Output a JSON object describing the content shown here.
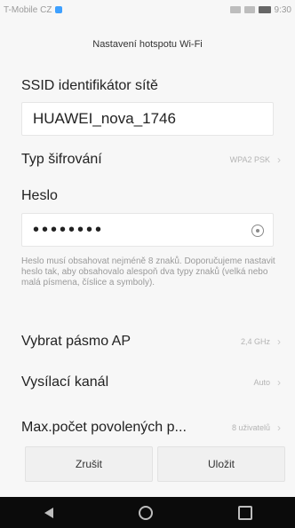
{
  "status_bar": {
    "carrier": "T-Mobile CZ",
    "time": "9:30"
  },
  "title": "Nastavení hotspotu Wi‑Fi",
  "ssid": {
    "label": "SSID identifikátor sítě",
    "value": "HUAWEI_nova_1746"
  },
  "encryption": {
    "label": "Typ šifrování",
    "value": "WPA2 PSK"
  },
  "password": {
    "label": "Heslo",
    "value_masked": "••••••••",
    "help": "Heslo musí obsahovat nejméně 8 znaků. Doporučujeme nastavit heslo tak, aby obsahovalo alespoň dva typy znaků (velká nebo malá písmena, číslice a symboly)."
  },
  "settings": {
    "band": {
      "label": "Vybrat pásmo AP",
      "value": "2,4 GHz"
    },
    "channel": {
      "label": "Vysílací kanál",
      "value": "Auto"
    },
    "max_users": {
      "label": "Max.počet povolených p...",
      "value": "8 uživatelů"
    }
  },
  "buttons": {
    "cancel": "Zrušit",
    "save": "Uložit"
  },
  "icons": {
    "chevron": "›",
    "eye": "eye-icon"
  }
}
